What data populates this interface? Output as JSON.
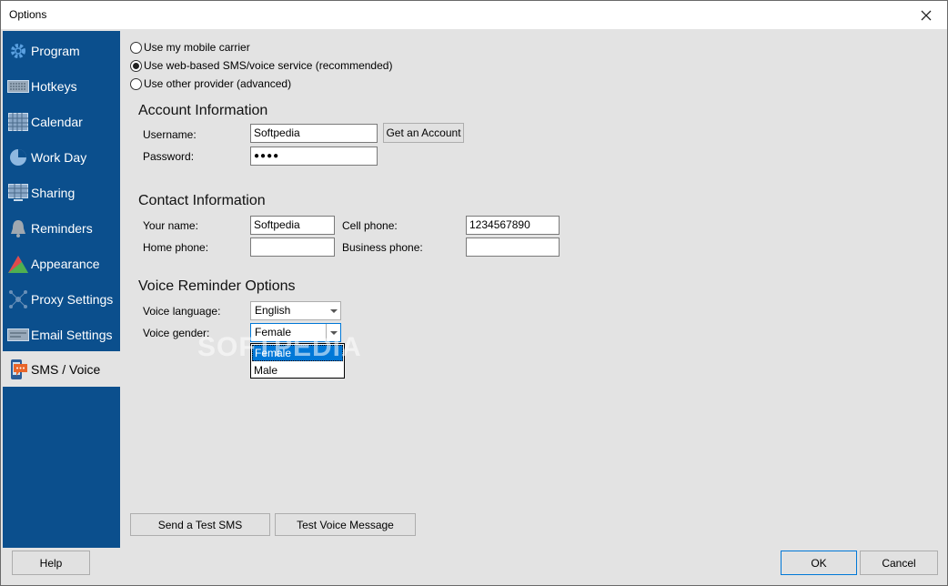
{
  "window": {
    "title": "Options"
  },
  "sidebar": {
    "items": [
      {
        "label": "Program",
        "icon": "gear-icon"
      },
      {
        "label": "Hotkeys",
        "icon": "keyboard-icon"
      },
      {
        "label": "Calendar",
        "icon": "calendar-icon"
      },
      {
        "label": "Work Day",
        "icon": "pie-clock-icon"
      },
      {
        "label": "Sharing",
        "icon": "sharing-icon"
      },
      {
        "label": "Reminders",
        "icon": "bell-icon"
      },
      {
        "label": "Appearance",
        "icon": "palette-icon"
      },
      {
        "label": "Proxy Settings",
        "icon": "network-icon"
      },
      {
        "label": "Email Settings",
        "icon": "email-icon"
      },
      {
        "label": "SMS / Voice",
        "icon": "sms-icon",
        "active": true
      }
    ]
  },
  "service": {
    "options": [
      {
        "label": "Use my mobile carrier",
        "checked": false
      },
      {
        "label": "Use web-based SMS/voice service (recommended)",
        "checked": true
      },
      {
        "label": "Use other provider (advanced)",
        "checked": false
      }
    ]
  },
  "account": {
    "title": "Account Information",
    "username_label": "Username:",
    "username_value": "Softpedia",
    "password_label": "Password:",
    "password_value": "●●●●",
    "get_account_label": "Get an Account"
  },
  "contact": {
    "title": "Contact Information",
    "your_name_label": "Your name:",
    "your_name_value": "Softpedia",
    "cell_phone_label": "Cell phone:",
    "cell_phone_value": "1234567890",
    "home_phone_label": "Home phone:",
    "home_phone_value": "",
    "business_phone_label": "Business phone:",
    "business_phone_value": ""
  },
  "voice": {
    "title": "Voice Reminder Options",
    "language_label": "Voice language:",
    "language_value": "English",
    "gender_label": "Voice gender:",
    "gender_value": "Female",
    "gender_options": [
      "Female",
      "Male"
    ]
  },
  "watermark": "SOFTPEDIA",
  "actions": {
    "send_test_sms": "Send a Test SMS",
    "test_voice": "Test Voice Message",
    "help": "Help",
    "ok": "OK",
    "cancel": "Cancel"
  },
  "colors": {
    "sidebar": "#0b4f8d",
    "selection": "#0078d7"
  }
}
